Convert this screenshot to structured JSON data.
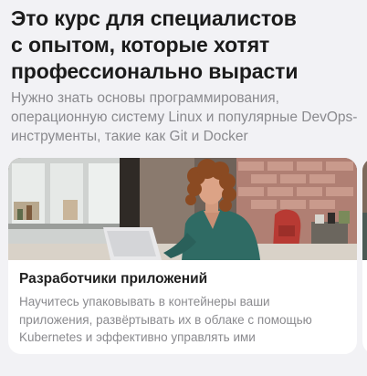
{
  "header": {
    "title_lines": [
      "Это курс для специалистов",
      "с опытом, которые хотят",
      "профессионально вырасти"
    ],
    "subtitle_lines": [
      "Нужно знать основы программирования,",
      "операционную систему Linux и популярные DevOps-",
      "инструменты, такие как Git и Docker"
    ]
  },
  "cards": [
    {
      "image": "developer-at-laptop-photo",
      "title": "Разработчики приложений",
      "description_lines": [
        "Научитесь упаковывать в контейнеры ваши",
        "приложения, развёртывать их в облаке с помощью",
        "Kubernetes и эффективно управлять ими"
      ]
    }
  ],
  "colors": {
    "background": "#f2f2f5",
    "card": "#ffffff",
    "heading": "#1b1b1b",
    "muted_text": "#8a8a8e"
  }
}
